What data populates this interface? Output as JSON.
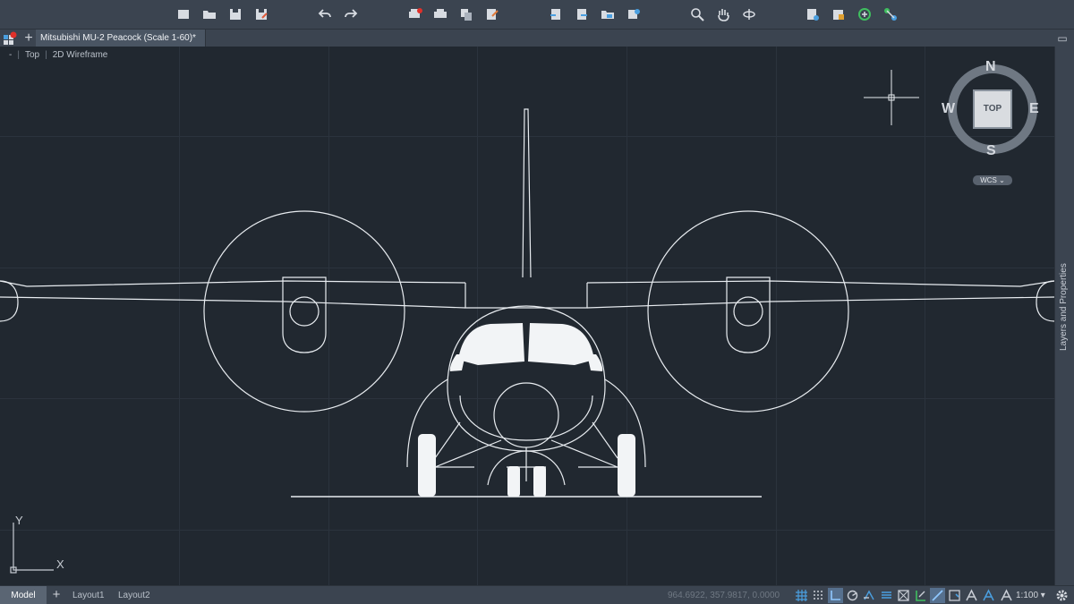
{
  "toolbar": {
    "icons": [
      "new-icon",
      "open-icon",
      "save-icon",
      "save-as-icon",
      "undo-icon",
      "redo-icon",
      "plot-icon",
      "print-icon",
      "copy-icon",
      "publish-icon",
      "sheet-icon",
      "export-icon",
      "folder-icon",
      "share-icon",
      "zoom-icon",
      "pan-icon",
      "orbit-icon",
      "properties-icon",
      "layer-icon",
      "refresh-icon",
      "connect-icon"
    ]
  },
  "tabs": {
    "document_title": "Mitsubishi MU-2 Peacock (Scale 1-60)*",
    "new_tab": "+"
  },
  "viewport": {
    "menu_symbol": "-",
    "view_name": "Top",
    "visual_style": "2D Wireframe"
  },
  "viewcube": {
    "north": "N",
    "south": "S",
    "east": "E",
    "west": "W",
    "face": "TOP",
    "ucs": "WCS"
  },
  "ucs_icon": {
    "x_label": "X",
    "y_label": "Y"
  },
  "side_panel": {
    "label": "Layers and Properties"
  },
  "statusbar": {
    "model_tab": "Model",
    "add_layout": "+",
    "layouts": [
      "Layout1",
      "Layout2"
    ],
    "coordinates": "964.6922, 357.9817, 0.0000",
    "scale": "1:100"
  },
  "colors": {
    "background": "#212830",
    "chrome": "#3b4450",
    "drawing_lines": "#e8ecf0",
    "accent": "#4a9fe0"
  }
}
